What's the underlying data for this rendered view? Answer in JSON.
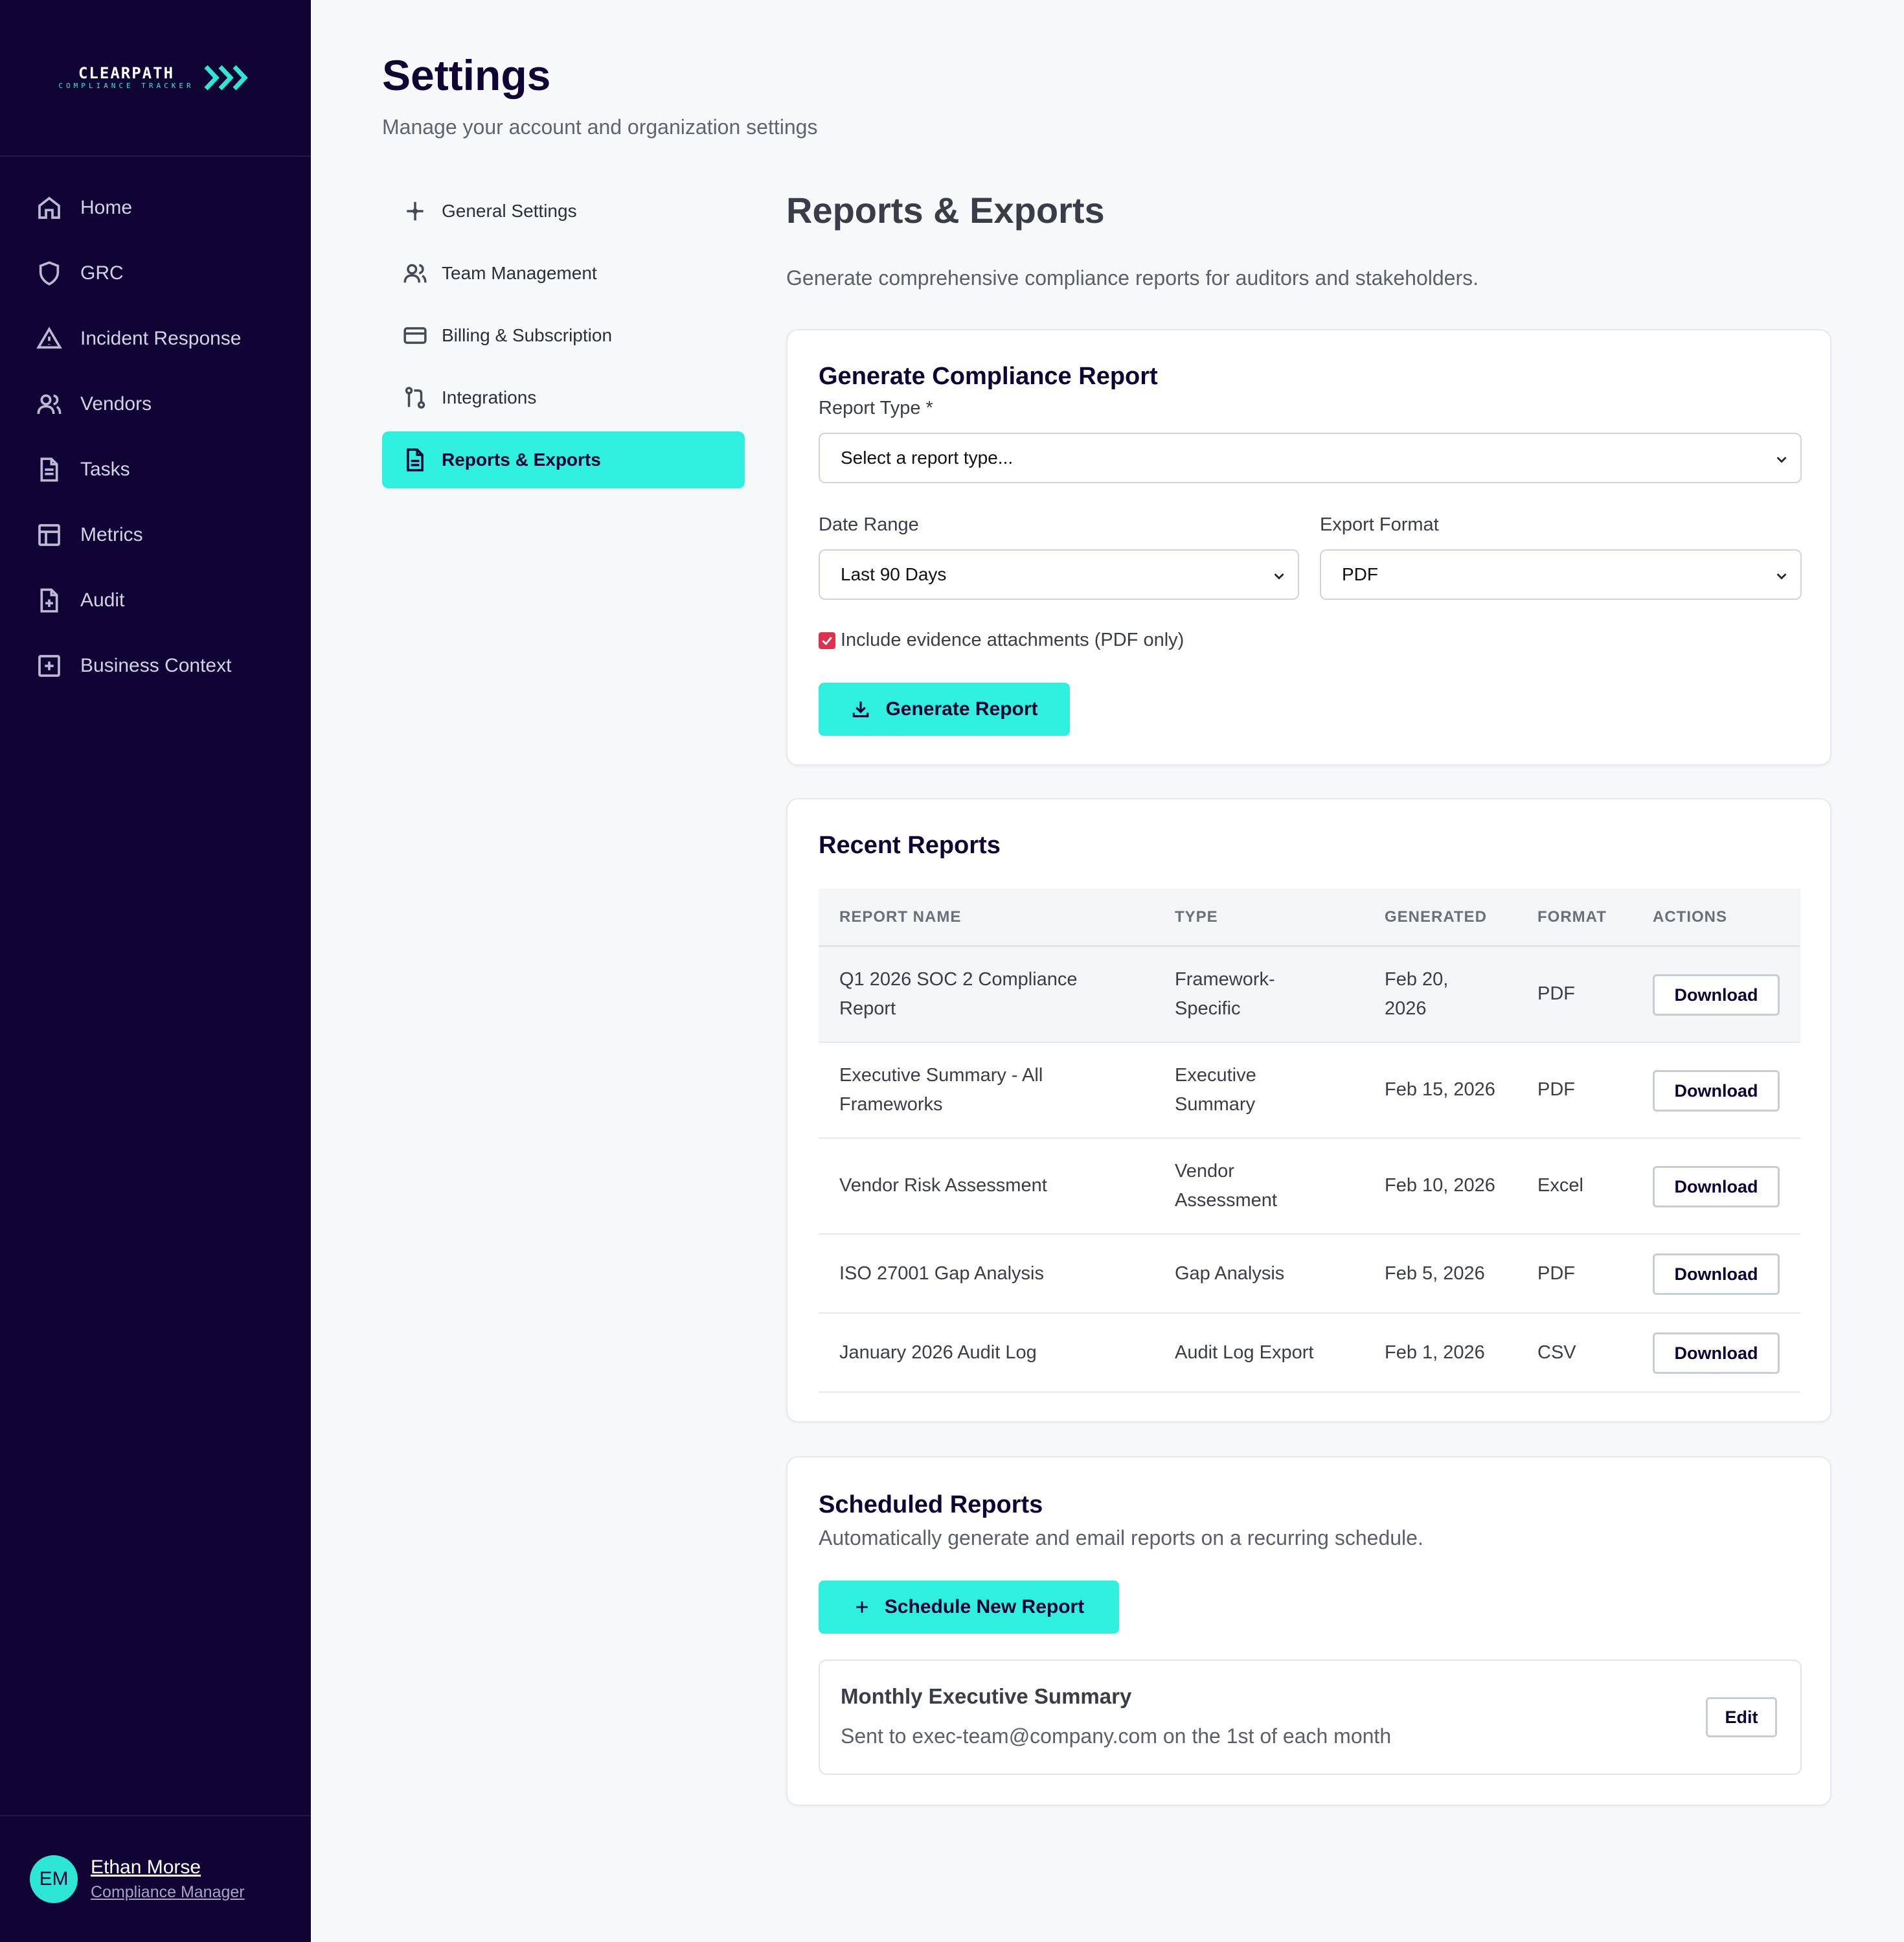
{
  "brand": {
    "name": "CLEARPATH",
    "tagline": "COMPLIANCE TRACKER",
    "accent": "#2ff0de",
    "sidebar_bg": "#0f0433"
  },
  "sidebar": {
    "items": [
      {
        "label": "Home",
        "icon": "home-icon"
      },
      {
        "label": "GRC",
        "icon": "shield-icon"
      },
      {
        "label": "Incident Response",
        "icon": "warning-icon"
      },
      {
        "label": "Vendors",
        "icon": "users-icon"
      },
      {
        "label": "Tasks",
        "icon": "document-icon"
      },
      {
        "label": "Metrics",
        "icon": "layout-icon"
      },
      {
        "label": "Audit",
        "icon": "file-plus-icon"
      },
      {
        "label": "Business Context",
        "icon": "square-plus-icon"
      }
    ],
    "user": {
      "initials": "EM",
      "name": "Ethan Morse",
      "role": "Compliance Manager"
    }
  },
  "header": {
    "title": "Settings",
    "subtitle": "Manage your account and organization settings"
  },
  "settings_nav": {
    "items": [
      {
        "label": "General Settings",
        "icon": "sliders-icon",
        "active": false
      },
      {
        "label": "Team Management",
        "icon": "users-icon",
        "active": false
      },
      {
        "label": "Billing & Subscription",
        "icon": "credit-card-icon",
        "active": false
      },
      {
        "label": "Integrations",
        "icon": "git-pull-icon",
        "active": false
      },
      {
        "label": "Reports & Exports",
        "icon": "file-text-icon",
        "active": true
      }
    ]
  },
  "reports": {
    "title": "Reports & Exports",
    "subtitle": "Generate comprehensive compliance reports for auditors and stakeholders.",
    "generate": {
      "title": "Generate Compliance Report",
      "report_type_label": "Report Type *",
      "report_type_value": "Select a report type...",
      "date_range_label": "Date Range",
      "date_range_value": "Last 90 Days",
      "export_format_label": "Export Format",
      "export_format_value": "PDF",
      "checkbox_label": "Include evidence attachments (PDF only)",
      "checkbox_checked": true,
      "button_label": "Generate Report"
    },
    "recent": {
      "title": "Recent Reports",
      "columns": [
        "REPORT NAME",
        "TYPE",
        "GENERATED",
        "FORMAT",
        "ACTIONS"
      ],
      "rows": [
        {
          "name": [
            "Q1 2026 SOC 2 Compliance",
            "Report"
          ],
          "type": [
            "Framework-",
            "Specific"
          ],
          "generated": [
            "Feb 20,",
            "2026"
          ],
          "format": "PDF",
          "action": "Download"
        },
        {
          "name": [
            "Executive Summary - All",
            "Frameworks"
          ],
          "type": [
            "Executive",
            "Summary"
          ],
          "generated": [
            "Feb 15, 2026"
          ],
          "format": "PDF",
          "action": "Download"
        },
        {
          "name": [
            "Vendor Risk Assessment"
          ],
          "type": [
            "Vendor",
            "Assessment"
          ],
          "generated": [
            "Feb 10, 2026"
          ],
          "format": "Excel",
          "action": "Download"
        },
        {
          "name": [
            "ISO 27001 Gap Analysis"
          ],
          "type": [
            "Gap Analysis"
          ],
          "generated": [
            "Feb 5, 2026"
          ],
          "format": "PDF",
          "action": "Download"
        },
        {
          "name": [
            "January 2026 Audit Log"
          ],
          "type": [
            "Audit Log Export"
          ],
          "generated": [
            "Feb 1, 2026"
          ],
          "format": "CSV",
          "action": "Download"
        }
      ]
    },
    "scheduled": {
      "title": "Scheduled Reports",
      "subtitle": "Automatically generate and email reports on a recurring schedule.",
      "button_label": "Schedule New Report",
      "items": [
        {
          "title": "Monthly Executive Summary",
          "detail": "Sent to exec-team@company.com on the 1st of each month",
          "action": "Edit"
        }
      ]
    }
  }
}
